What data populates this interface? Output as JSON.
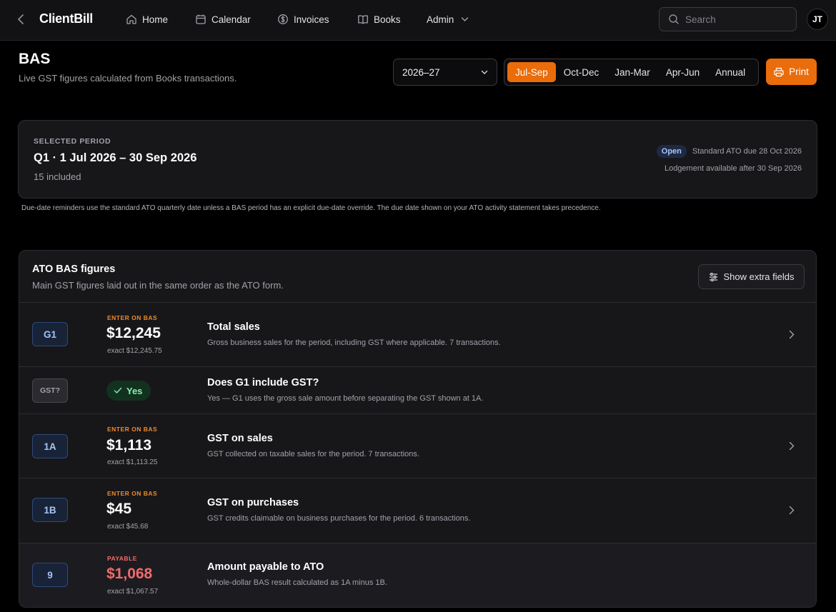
{
  "app": {
    "brand": "ClientBill"
  },
  "nav": {
    "home": "Home",
    "calendar": "Calendar",
    "invoices": "Invoices",
    "books": "Books",
    "admin": "Admin"
  },
  "search": {
    "placeholder": "Search"
  },
  "user": {
    "initials": "JT"
  },
  "page": {
    "title": "BAS",
    "subtitle": "Live GST figures calculated from Books transactions."
  },
  "controls": {
    "year": "2026–27",
    "periods": [
      "Jul-Sep",
      "Oct-Dec",
      "Jan-Mar",
      "Apr-Jun",
      "Annual"
    ],
    "active_period": "Jul-Sep",
    "print_label": "Print"
  },
  "period_card": {
    "label": "SELECTED PERIOD",
    "range": "Q1 · 1 Jul 2026 – 30 Sep 2026",
    "count": "15 included",
    "status": "Open",
    "due": "Standard ATO due 28 Oct 2026",
    "lodgement": "Lodgement available after 30 Sep 2026"
  },
  "note": "Due-date reminders use the standard ATO quarterly date unless a BAS period has an explicit due-date override. The due date shown on your ATO activity statement takes precedence.",
  "bas": {
    "title": "ATO BAS figures",
    "subtitle": "Main GST figures laid out in the same order as the ATO form.",
    "extra_button": "Show extra fields",
    "rows": [
      {
        "code": "G1",
        "kicker": "ENTER ON BAS",
        "amount": "$12,245",
        "exact": "exact $12,245.75",
        "title": "Total sales",
        "desc": "Gross business sales for the period, including GST where applicable. 7 transactions."
      },
      {
        "code": "GST?",
        "answer": "Yes",
        "title": "Does G1 include GST?",
        "desc": "Yes — G1 uses the gross sale amount before separating the GST shown at 1A."
      },
      {
        "code": "1A",
        "kicker": "ENTER ON BAS",
        "amount": "$1,113",
        "exact": "exact $1,113.25",
        "title": "GST on sales",
        "desc": "GST collected on taxable sales for the period. 7 transactions."
      },
      {
        "code": "1B",
        "kicker": "ENTER ON BAS",
        "amount": "$45",
        "exact": "exact $45.68",
        "title": "GST on purchases",
        "desc": "GST credits claimable on business purchases for the period. 6 transactions."
      },
      {
        "code": "9",
        "kicker": "PAYABLE",
        "amount": "$1,068",
        "exact": "exact $1,067.57",
        "title": "Amount payable to ATO",
        "desc": "Whole-dollar BAS result calculated as 1A minus 1B."
      }
    ]
  },
  "colors": {
    "accent": "#ea6c0a",
    "payable": "#f26b6b",
    "badge": "#a6c2f3",
    "success": "#86efac"
  }
}
